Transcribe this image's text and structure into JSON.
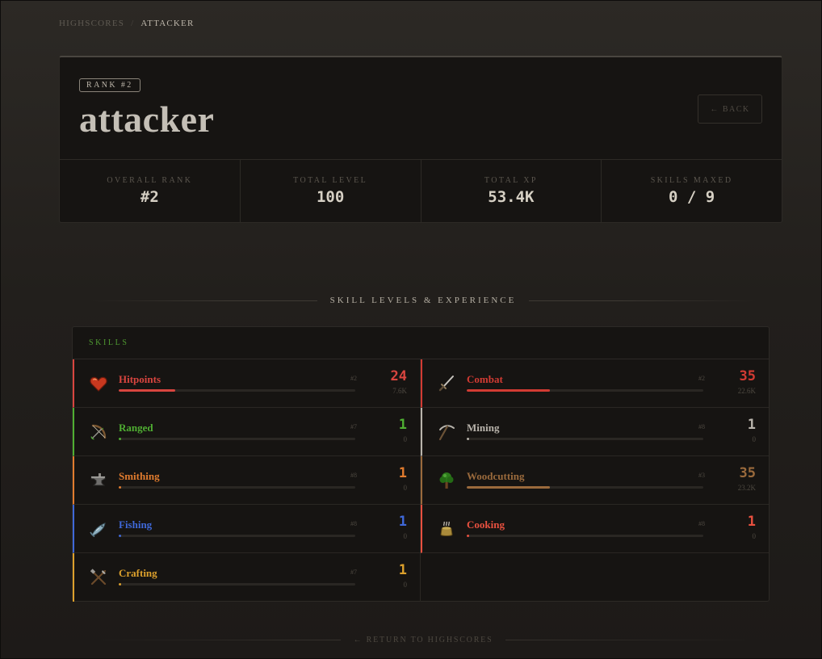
{
  "breadcrumb": {
    "root": "Highscores",
    "separator": "/",
    "current": "Attacker"
  },
  "profile": {
    "rank_badge": "Rank #2",
    "name": "attacker",
    "back_label": "← Back"
  },
  "stats": [
    {
      "label": "Overall Rank",
      "value": "#2"
    },
    {
      "label": "Total Level",
      "value": "100"
    },
    {
      "label": "Total XP",
      "value": "53.4K"
    },
    {
      "label": "Skills Maxed",
      "value": "0 / 9"
    }
  ],
  "section_title": "Skill Levels & Experience",
  "skills_header": "Skills",
  "skills": [
    {
      "name": "Hitpoints",
      "rank": "#2",
      "level": "24",
      "xp": "7.6K",
      "progress": 0.24,
      "color": "#d8453f",
      "icon": "heart-icon"
    },
    {
      "name": "Combat",
      "rank": "#2",
      "level": "35",
      "xp": "22.6K",
      "progress": 0.35,
      "color": "#d23b33",
      "icon": "sword-icon"
    },
    {
      "name": "Ranged",
      "rank": "#7",
      "level": "1",
      "xp": "0",
      "progress": 0.01,
      "color": "#4fae32",
      "icon": "bow-icon"
    },
    {
      "name": "Mining",
      "rank": "#8",
      "level": "1",
      "xp": "0",
      "progress": 0.01,
      "color": "#b9b4ac",
      "icon": "pickaxe-icon"
    },
    {
      "name": "Smithing",
      "rank": "#8",
      "level": "1",
      "xp": "0",
      "progress": 0.01,
      "color": "#e07b2e",
      "icon": "anvil-icon"
    },
    {
      "name": "Woodcutting",
      "rank": "#3",
      "level": "35",
      "xp": "23.2K",
      "progress": 0.35,
      "color": "#9a6a3c",
      "icon": "tree-icon"
    },
    {
      "name": "Fishing",
      "rank": "#8",
      "level": "1",
      "xp": "0",
      "progress": 0.01,
      "color": "#3f68d8",
      "icon": "fish-icon"
    },
    {
      "name": "Cooking",
      "rank": "#8",
      "level": "1",
      "xp": "0",
      "progress": 0.01,
      "color": "#e8503f",
      "icon": "cooking-pot-icon"
    },
    {
      "name": "Crafting",
      "rank": "#7",
      "level": "1",
      "xp": "0",
      "progress": 0.01,
      "color": "#dca02c",
      "icon": "crafting-tools-icon"
    }
  ],
  "footer_link": "← Return to Highscores"
}
